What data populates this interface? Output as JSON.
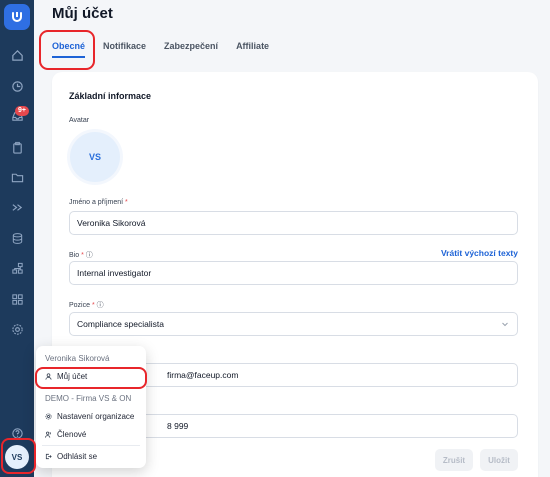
{
  "page": {
    "title": "Můj účet"
  },
  "sidebar": {
    "badge": "9+",
    "avatar_initials": "VS",
    "icons": [
      "home-icon",
      "clock-icon",
      "inbox-icon",
      "clipboard-icon",
      "folder-icon",
      "arrows-icon",
      "database-icon",
      "nodes-icon",
      "grid-icon",
      "settings-icon",
      "help-icon"
    ]
  },
  "tabs": [
    {
      "label": "Obecné",
      "active": true
    },
    {
      "label": "Notifikace",
      "active": false
    },
    {
      "label": "Zabezpečení",
      "active": false
    },
    {
      "label": "Affiliate",
      "active": false
    }
  ],
  "form": {
    "section_title": "Základní informace",
    "avatar_label": "Avatar",
    "avatar_initials": "VS",
    "name_label": "Jméno a příjmení",
    "name_value": "Veronika Sikorová",
    "bio_label": "Bio",
    "bio_value": "Internal investigator",
    "reset_link": "Vrátit výchozí texty",
    "position_label": "Pozice",
    "position_value": "Compliance specialista",
    "email_value_visible": "firma@faceup.com",
    "phone_value_visible": "8 999",
    "required_mark": "*",
    "cancel_label": "Zrušit",
    "save_label": "Uložit"
  },
  "menu": {
    "user_name": "Veronika Sikorová",
    "my_account": "Můj účet",
    "org_name": "DEMO - Firma VS & ON",
    "org_settings": "Nastavení organizace",
    "members": "Členové",
    "logout": "Odhlásit se"
  },
  "colors": {
    "sidebar": "#1d3a5c",
    "accent": "#1e63d6",
    "highlight": "#e8262b"
  }
}
